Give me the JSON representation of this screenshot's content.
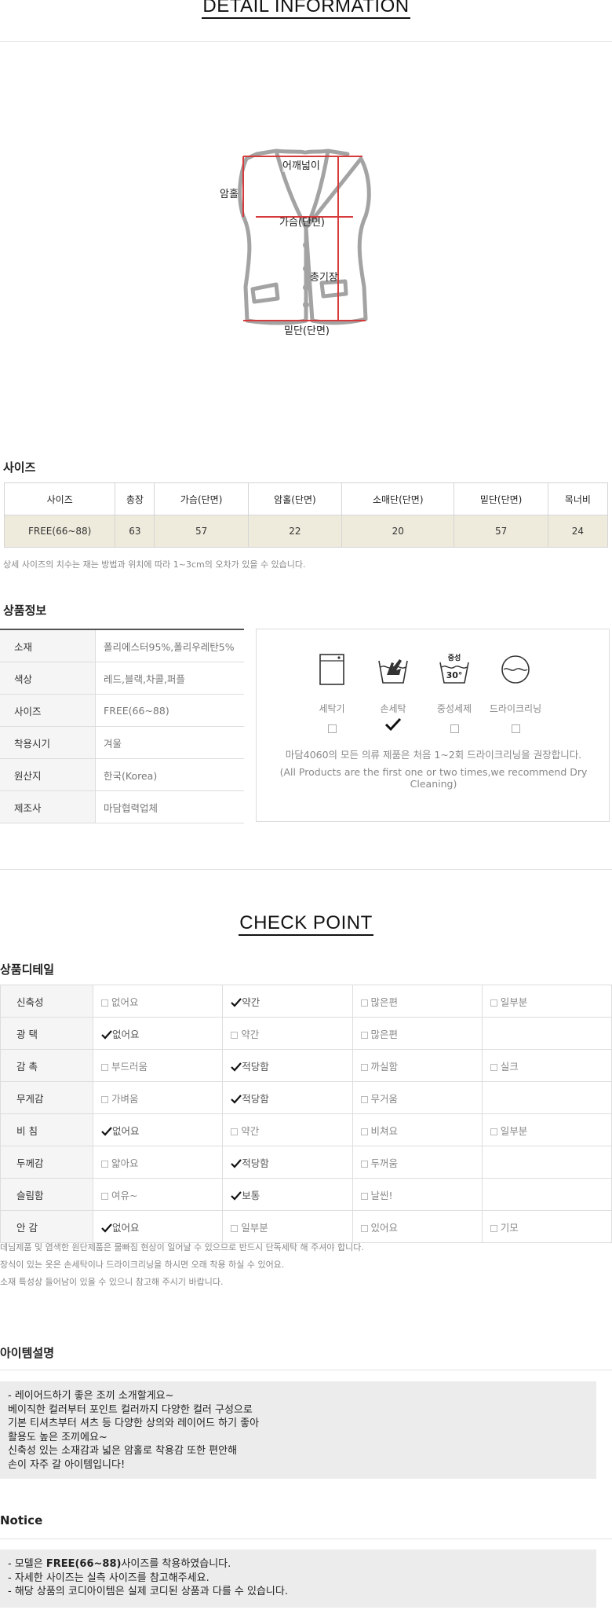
{
  "detail_title": "DETAIL INFORMATION",
  "diagram": {
    "labels": {
      "shoulder": "어깨넓이",
      "armhole": "암홀",
      "chest": "가슴(단면)",
      "length": "총기장",
      "hem": "밑단(단면)"
    },
    "colors": {
      "outline": "#9a9a9a",
      "measure": "#d63b3b"
    }
  },
  "size_section": {
    "title": "사이즈",
    "headers": [
      "사이즈",
      "총장",
      "가슴(단면)",
      "암홀(단면)",
      "소매단(단면)",
      "밑단(단면)",
      "목너비"
    ],
    "row": [
      "FREE(66~88)",
      "63",
      "57",
      "22",
      "20",
      "57",
      "24"
    ],
    "note": "상세 사이즈의 치수는 재는 방법과 위치에 따라 1~3cm의 오차가 있을 수 있습니다."
  },
  "product_info": {
    "title": "상품정보",
    "rows": [
      {
        "key": "소재",
        "value": "폴리에스터95%,폴리우레탄5%"
      },
      {
        "key": "색상",
        "value": "레드,블랙,차콜,퍼플"
      },
      {
        "key": "사이즈",
        "value": "FREE(66~88)"
      },
      {
        "key": "착용시기",
        "value": "겨울"
      },
      {
        "key": "원산지",
        "value": "한국(Korea)"
      },
      {
        "key": "제조사",
        "value": "마담협력업체"
      }
    ]
  },
  "washing": {
    "items": [
      {
        "label": "세탁기",
        "icon": "washing-machine-icon",
        "checked": false
      },
      {
        "label": "손세탁",
        "icon": "hand-wash-icon",
        "checked": true
      },
      {
        "label": "중성세제",
        "icon": "neutral-detergent-icon",
        "checked": false,
        "badge": "중성",
        "temp": "30°"
      },
      {
        "label": "드라이크리닝",
        "icon": "dry-cleaning-icon",
        "checked": false
      }
    ],
    "note_ko": "마담4060의 모든 의류 제품은 처음 1~2회 드라이크리닝을 권장합니다.",
    "note_en": "(All Products are the first one or two times,we recommend Dry Cleaning)"
  },
  "check_point": {
    "title": "CHECK POINT",
    "subtitle": "상품디테일",
    "rows": [
      {
        "key": "신축성",
        "options": [
          "없어요",
          "약간",
          "많은편",
          "일부분"
        ],
        "selected": 1
      },
      {
        "key": "광 택",
        "options": [
          "없어요",
          "약간",
          "많은편",
          ""
        ],
        "selected": 0
      },
      {
        "key": "감 촉",
        "options": [
          "부드러움",
          "적당함",
          "까실함",
          "실크"
        ],
        "selected": 1
      },
      {
        "key": "무게감",
        "options": [
          "가벼움",
          "적당함",
          "무거움",
          ""
        ],
        "selected": 1
      },
      {
        "key": "비 침",
        "options": [
          "없어요",
          "약간",
          "비쳐요",
          "일부분"
        ],
        "selected": 0
      },
      {
        "key": "두께감",
        "options": [
          "얇아요",
          "적당함",
          "두꺼움",
          ""
        ],
        "selected": 1
      },
      {
        "key": "슬림함",
        "options": [
          "여유~",
          "보통",
          "날씬!",
          ""
        ],
        "selected": 1
      },
      {
        "key": "안 감",
        "options": [
          "없어요",
          "일부분",
          "있어요",
          "기모"
        ],
        "selected": 0
      }
    ],
    "notes": [
      "데님제품 및 염색한 원단제품은 물빠짐 현상이 일어날 수 있으므로 반드시 단독세탁 해 주셔야 합니다.",
      "장식이 있는 옷은 손세탁이나 드라이크리닝을 하시면 오래 착용 하실 수 있어요.",
      "소재 특성상 들어남이 있을 수 있으니 참고해 주시기 바랍니다."
    ]
  },
  "item_description": {
    "title": "아이템설명",
    "lines": [
      "- 레이어드하기 좋은 조끼 소개할게요~",
      "베이직한 컬러부터 포인트 컬러까지 다양한 컬러 구성으로",
      "기본 티셔츠부터 셔츠 등 다양한 상의와 레이어드 하기 좋아",
      "활용도 높은 조끼에요~",
      "신축성 있는 소재감과 넓은 암홀로 착용감 또한 편안해",
      "손이 자주 갈 아이템입니다!"
    ]
  },
  "notice": {
    "title": "Notice",
    "line1_prefix": "- 모델은 ",
    "line1_bold": "FREE(66~88)",
    "line1_suffix": "사이즈를 착용하였습니다.",
    "line2": "- 자세한 사이즈는 실측 사이즈를 참고해주세요.",
    "line3": "- 해당 상품의 코디아이템은 실제 코디된 상품과 다를 수 있습니다."
  }
}
